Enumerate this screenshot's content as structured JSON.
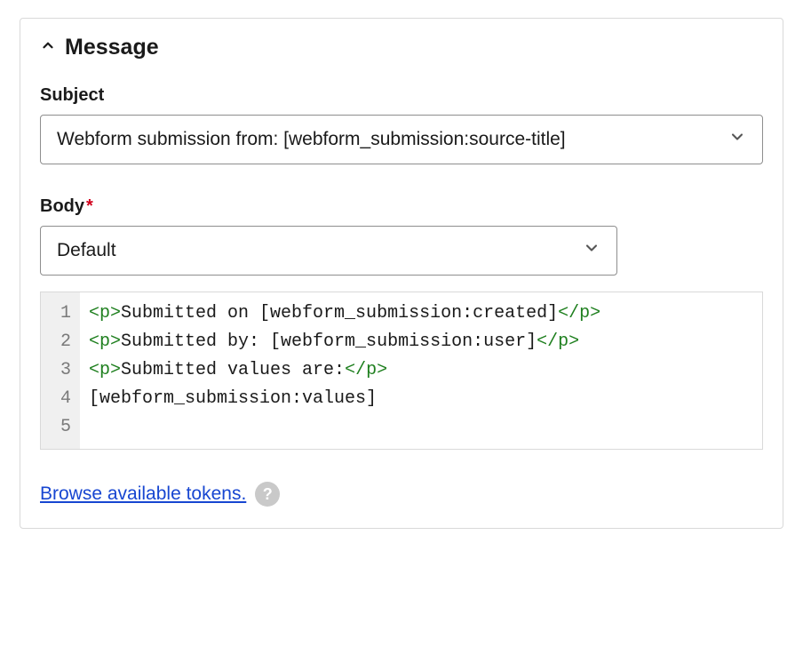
{
  "panel": {
    "title": "Message"
  },
  "subject": {
    "label": "Subject",
    "value": "Webform submission from: [webform_submission:source-title]"
  },
  "body": {
    "label": "Body",
    "required_mark": "*",
    "select_value": "Default",
    "code_lines": [
      {
        "n": "1",
        "tag_open": "<p>",
        "text": "Submitted on [webform_submission:created]",
        "tag_close": "</p>"
      },
      {
        "n": "2",
        "tag_open": "<p>",
        "text": "Submitted by: [webform_submission:user]",
        "tag_close": "</p>"
      },
      {
        "n": "3",
        "tag_open": "<p>",
        "text": "Submitted values are:",
        "tag_close": "</p>"
      },
      {
        "n": "4",
        "tag_open": "",
        "text": "[webform_submission:values]",
        "tag_close": ""
      },
      {
        "n": "5",
        "tag_open": "",
        "text": "",
        "tag_close": ""
      }
    ]
  },
  "footer": {
    "tokens_link": "Browse available tokens.",
    "help_glyph": "?"
  }
}
